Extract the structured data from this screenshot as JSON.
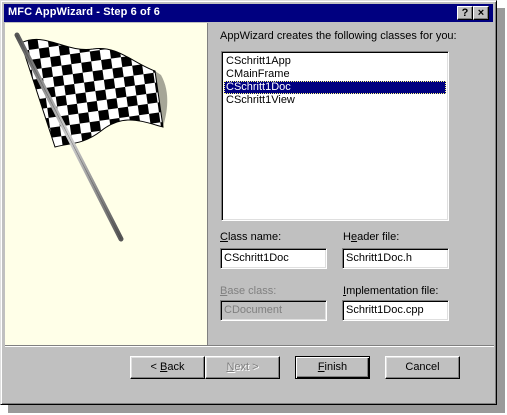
{
  "window": {
    "title": "MFC AppWizard - Step 6 of 6",
    "help_glyph": "?",
    "close_glyph": "×"
  },
  "intro_label": "AppWizard creates the following classes for you:",
  "classes_list": {
    "items": [
      "CSchritt1App",
      "CMainFrame",
      "CSchritt1Doc",
      "CSchritt1View"
    ],
    "selected_index": 2
  },
  "fields": {
    "class_name": {
      "label_pre": "",
      "label_ul": "C",
      "label_post": "lass name:",
      "value": "CSchritt1Doc"
    },
    "header_file": {
      "label_pre": "H",
      "label_ul": "e",
      "label_post": "ader file:",
      "value": "Schritt1Doc.h"
    },
    "base_class": {
      "label_pre": "",
      "label_ul": "B",
      "label_post": "ase class:",
      "value": "CDocument",
      "disabled": true
    },
    "implementation_file": {
      "label_pre": "",
      "label_ul": "I",
      "label_post": "mplementation file:",
      "value": "Schritt1Doc.cpp"
    }
  },
  "buttons": {
    "back": {
      "pre": "< ",
      "ul": "B",
      "post": "ack",
      "enabled": true
    },
    "next": {
      "pre": "",
      "ul": "N",
      "post": "ext >",
      "enabled": false
    },
    "finish": {
      "pre": "",
      "ul": "F",
      "post": "inish",
      "enabled": true
    },
    "cancel": {
      "pre": "Cancel",
      "ul": "",
      "post": "",
      "enabled": true
    }
  },
  "colors": {
    "titlebar": "#000080",
    "face": "#c0c0c0",
    "selection": "#000080",
    "art_background": "#ffffe8"
  },
  "icons": {
    "art": "checkered-flag-icon"
  }
}
